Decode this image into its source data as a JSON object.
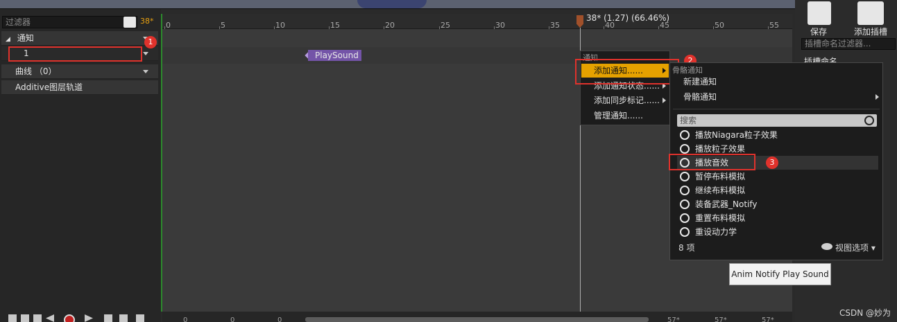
{
  "left_panel": {
    "filter_placeholder": "过滤器",
    "frame_label": "38*",
    "tracks": {
      "notify": "通知",
      "notify_track_1": "1",
      "curves": "曲线 （0）",
      "additive": "Additive图层轨道"
    }
  },
  "timeline": {
    "ticks": [
      "0",
      "5",
      "10",
      "15",
      "20",
      "25",
      "30",
      "35",
      "40",
      "45",
      "50",
      "55"
    ],
    "playhead_text": "38* (1.27) (66.46%)",
    "notify_tag": "PlaySound",
    "bottom_numbers": [
      "0",
      "0",
      "0",
      "57*",
      "57*",
      "57*"
    ]
  },
  "right_panel": {
    "save_label": "保存",
    "add_slot_label": "添加插槽",
    "slot_filter_placeholder": "插槽命名过滤器...",
    "slot_name_label": "插槽命名"
  },
  "context_menu": {
    "header": "通知",
    "items": [
      "添加通知......",
      "添加通知状态......",
      "添加同步标记......",
      "管理通知......"
    ]
  },
  "submenu": {
    "header": "骨骼通知",
    "new_notify": "新建通知",
    "skeleton_notify": "骨骼通知",
    "search_placeholder": "搜索",
    "notify_items": [
      "播放Niagara粒子效果",
      "播放粒子效果",
      "播放音效",
      "暂停布料模拟",
      "继续布料模拟",
      "装备武器_Notify",
      "重置布料模拟",
      "重设动力学"
    ],
    "count_label": "8 项",
    "view_options": "视图选项"
  },
  "tooltip": "Anim Notify Play Sound",
  "badges": [
    "1",
    "2",
    "3"
  ],
  "watermark": "CSDN @妙为",
  "icons": [
    "search-icon",
    "save-icon",
    "add-slot-icon",
    "circle-icon",
    "eye-icon",
    "record-icon"
  ],
  "colors": {
    "accent": "#e5a100",
    "highlight_box": "#e0322c",
    "notify_tag": "#7454a8"
  }
}
